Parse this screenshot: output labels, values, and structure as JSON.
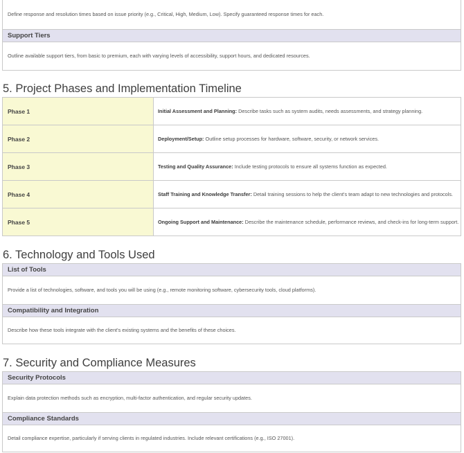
{
  "intro": {
    "text": "Define response and resolution times based on issue priority (e.g., Critical, High, Medium, Low). Specify guaranteed response times for each."
  },
  "support_tiers": {
    "title": "Support Tiers",
    "text": "Outline available support tiers, from basic to premium, each with varying levels of accessibility, support hours, and dedicated resources."
  },
  "section5": {
    "heading": "5. Project Phases and Implementation Timeline",
    "phases": [
      {
        "name": "Phase 1",
        "label": "Initial Assessment and Planning:",
        "text": " Describe tasks such as system audits, needs assessments, and strategy planning."
      },
      {
        "name": "Phase 2",
        "label": "Deployment/Setup:",
        "text": " Outline setup processes for hardware, software, security, or network services."
      },
      {
        "name": "Phase 3",
        "label": "Testing and Quality Assurance:",
        "text": " Include testing protocols to ensure all systems function as expected."
      },
      {
        "name": "Phase 4",
        "label": "Staff Training and Knowledge Transfer:",
        "text": " Detail training sessions to help the client's team adapt to new technologies and protocols."
      },
      {
        "name": "Phase 5",
        "label": "Ongoing Support and Maintenance:",
        "text": " Describe the maintenance schedule, performance reviews, and check-ins for long-term support."
      }
    ]
  },
  "section6": {
    "heading": "6. Technology and Tools Used",
    "list_of_tools": {
      "title": "List of Tools",
      "text": "Provide a list of technologies, software, and tools you will be using (e.g., remote monitoring software, cybersecurity tools, cloud platforms)."
    },
    "compatibility": {
      "title": "Compatibility and Integration",
      "text": "Describe how these tools integrate with the client's existing systems and the benefits of these choices."
    }
  },
  "section7": {
    "heading": "7. Security and Compliance Measures",
    "security_protocols": {
      "title": "Security Protocols",
      "text": "Explain data protection methods such as encryption, multi-factor authentication, and regular security updates."
    },
    "compliance_standards": {
      "title": "Compliance Standards",
      "text": "Detail compliance expertise, particularly if serving clients in regulated industries. Include relevant certifications (e.g., ISO 27001)."
    }
  }
}
